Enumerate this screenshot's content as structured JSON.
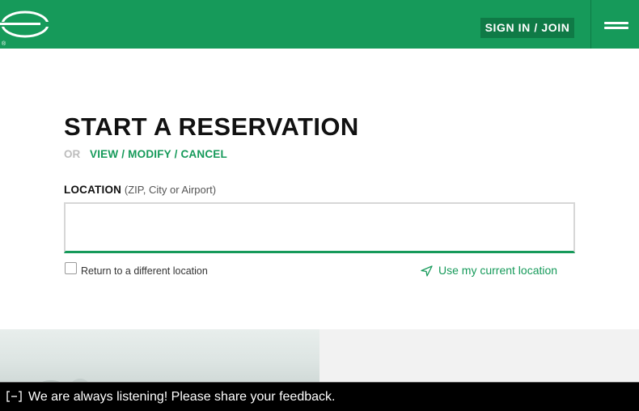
{
  "header": {
    "logo_registered": "®",
    "signin_label": "SIGN IN / JOIN",
    "colors": {
      "brand_green": "#169a5a",
      "dark_green": "#0f7a46"
    }
  },
  "reservation": {
    "title": "START A RESERVATION",
    "or_label": "OR",
    "view_modify_cancel_label": "VIEW / MODIFY / CANCEL",
    "location_label": "LOCATION",
    "location_hint": "(ZIP, City or Airport)",
    "location_value": "",
    "return_different_label": "Return to a different location",
    "return_different_checked": false,
    "use_current_location_label": "Use my current location",
    "use_current_location_icon": "navigation-arrow-icon"
  },
  "feedback": {
    "icon": "feedback-minimize-icon",
    "text": "We are always listening! Please share your feedback."
  }
}
